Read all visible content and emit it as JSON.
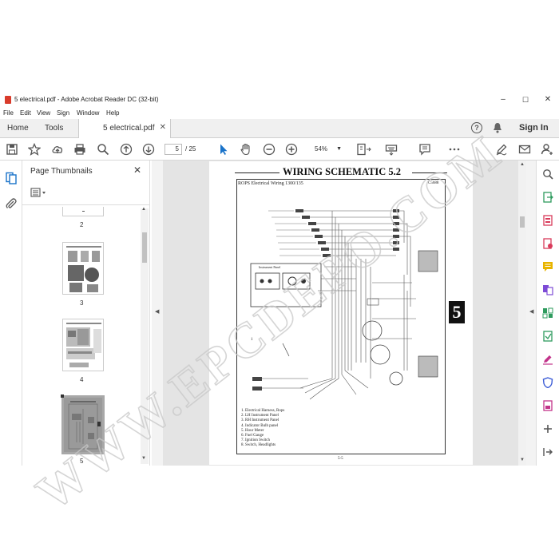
{
  "window": {
    "title": "5 electrical.pdf - Adobe Acrobat Reader DC (32-bit)",
    "minimize": "–",
    "maximize": "☐",
    "close": "✕"
  },
  "menu": [
    "File",
    "Edit",
    "View",
    "Sign",
    "Window",
    "Help"
  ],
  "tabs": {
    "home": "Home",
    "tools": "Tools",
    "document": "5 electrical.pdf",
    "close": "✕",
    "help": "?",
    "signin": "Sign In"
  },
  "toolbar": {
    "current_page": "5",
    "total_pages": "/ 25",
    "zoom": "54%"
  },
  "thumbnails": {
    "header": "Page Thumbnails",
    "close": "✕",
    "pages": [
      "2",
      "3",
      "4",
      "5"
    ],
    "selected": "5"
  },
  "document": {
    "heading": "WIRING SCHEMATIC 5.2",
    "subheading": "ROPS Electrical Wiring 1300/135",
    "code": "C5688",
    "section_tab": "5",
    "footer": "5-5",
    "panel_label": "Instrument Panel",
    "callout": "1",
    "legend": [
      "1.  Electrical Harness, Rops",
      "2.  LH Instrument Panel",
      "3.  RH Instrument Panel",
      "4.  Indicator Bulb panel",
      "5.  Hour Meter",
      "6.  Fuel Gauge",
      "7.  Ignition Switch",
      "8.  Switch, Headlights"
    ]
  },
  "watermark": "WWW.EPCDEPO.COM",
  "colors": {
    "pdf_red": "#d93b2b",
    "accent_blue": "#1a73c9",
    "doc_bg": "#e4e4e4"
  }
}
